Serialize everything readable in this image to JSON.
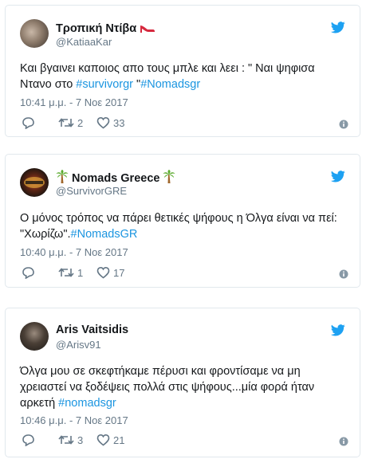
{
  "tweets": [
    {
      "name": "Τροπική Ντίβα",
      "handle": "@KatiaaKar",
      "text_plain": "Και βγαινει καποιος απο τους μπλε και λεει : \" Ναι ψηφισα Ντανο στο ",
      "tag1": "#survivorgr",
      "text_mid": " \"",
      "tag2": "#Nomadsgr",
      "time": "10:41 μ.μ. - 7 Νοε 2017",
      "retweets": "2",
      "likes": "33",
      "icons": {
        "name_emoji": "high-heel-icon",
        "avatar": "avatar-photo"
      }
    },
    {
      "name": "Nomads Greece",
      "handle": "@SurvivorGRE",
      "text_plain": "Ο μόνος τρόπος να πάρει θετικές ψήφους η Όλγα είναι να πεί: \"Χωρίζω\".",
      "tag1": "#NomadsGR",
      "time": "10:40 μ.μ. - 7 Νοε 2017",
      "retweets": "1",
      "likes": "17",
      "icons": {
        "name_emoji": "palm-tree-icon",
        "avatar": "survivor-logo"
      }
    },
    {
      "name": "Aris Vaitsidis",
      "handle": "@Arisv91",
      "text_plain": "Όλγα μου σε σκεφτήκαμε πέρυσι και φροντίσαμε να μη χρειαστεί να ξοδέψεις πολλά στις ψήφους...μία φορά ήταν αρκετή ",
      "tag1": "#nomadsgr",
      "time": "10:46 μ.μ. - 7 Νοε 2017",
      "retweets": "3",
      "likes": "21",
      "icons": {
        "name_emoji": "",
        "avatar": "avatar-photo"
      }
    }
  ],
  "colors": {
    "link": "#1b95e0",
    "muted": "#657786",
    "twitter": "#1da1f2",
    "border": "#e1e8ed"
  }
}
